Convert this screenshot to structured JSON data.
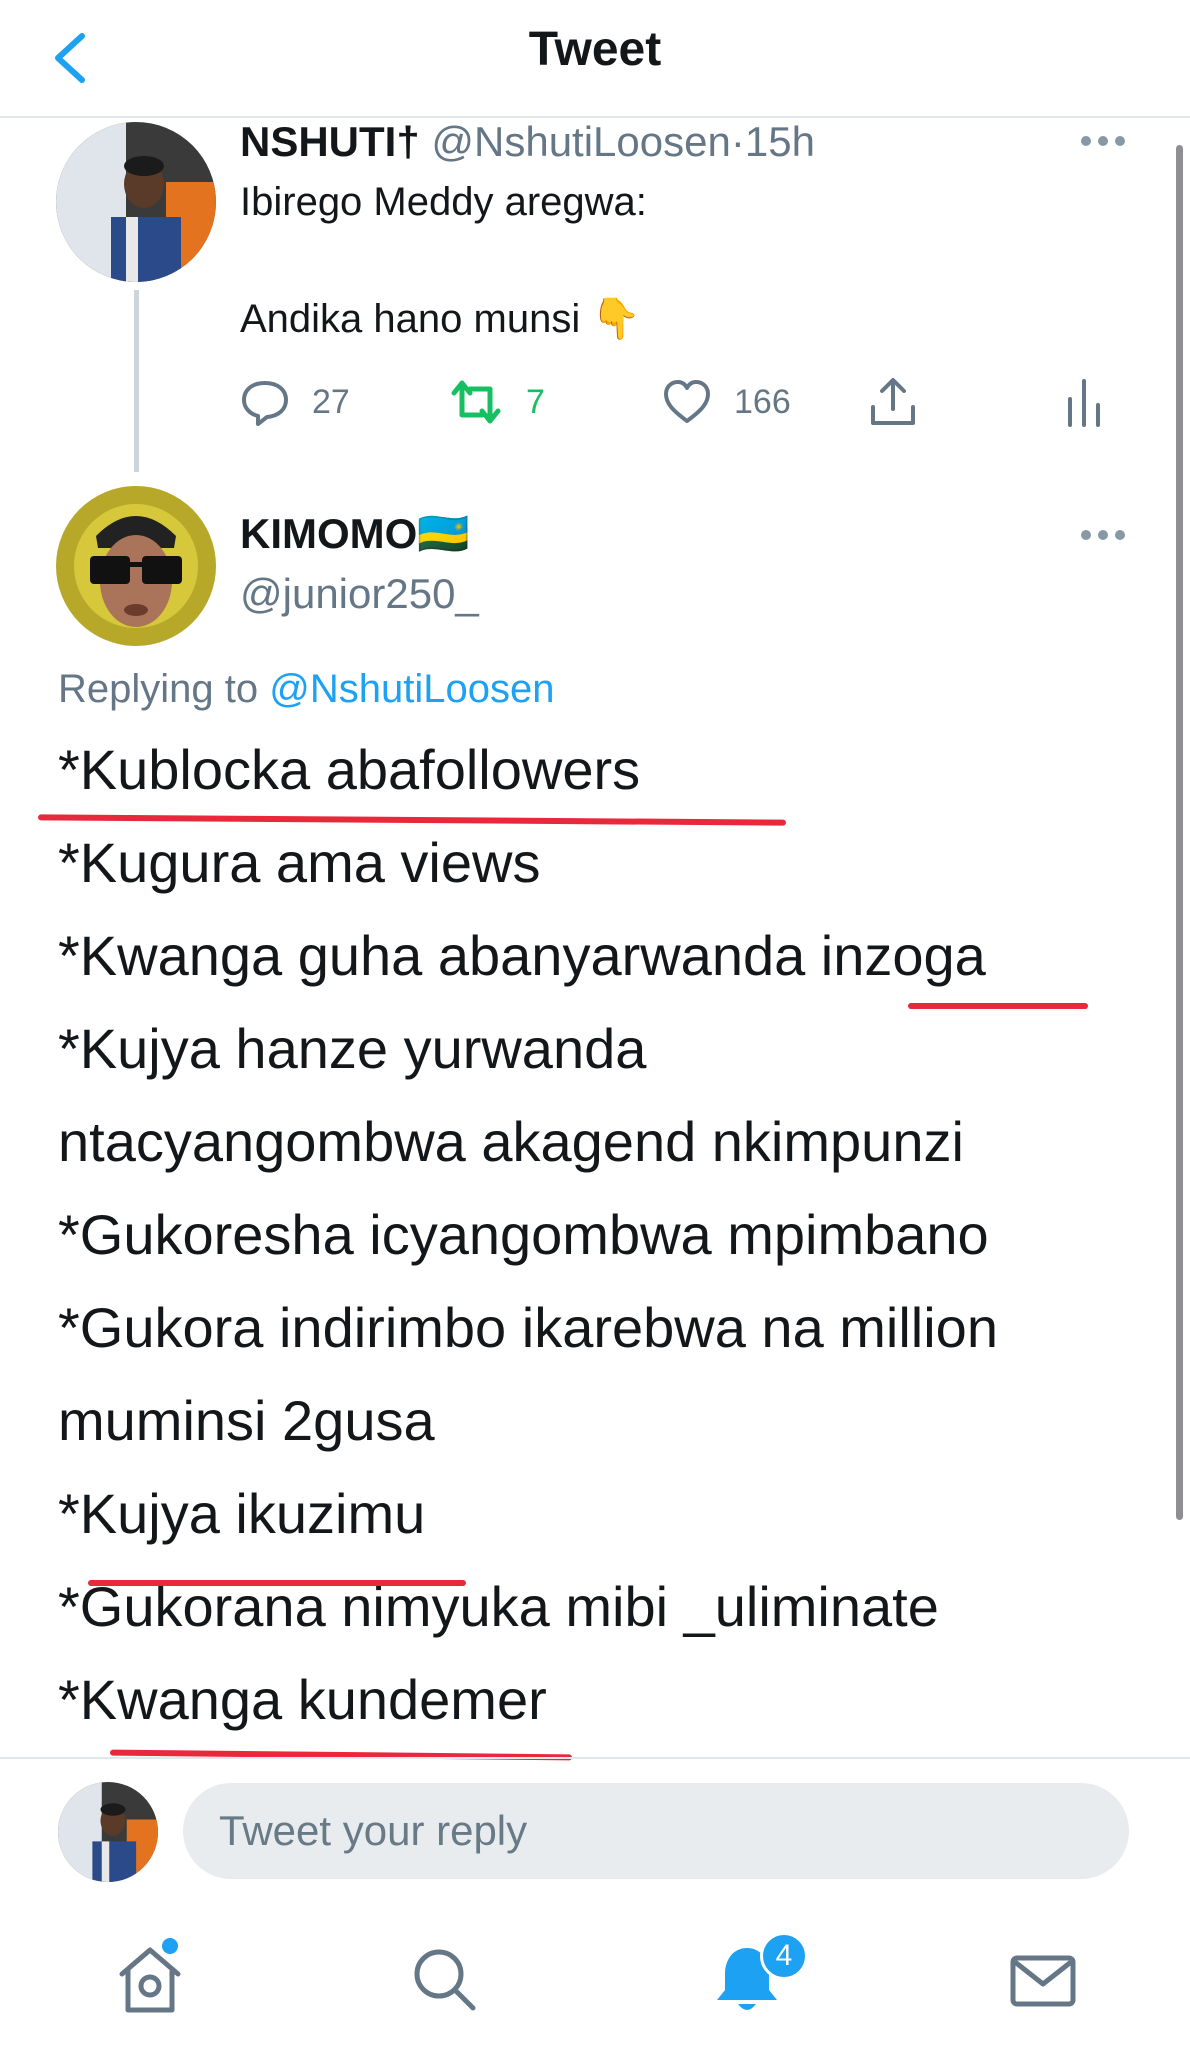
{
  "header": {
    "title": "Tweet"
  },
  "parent_tweet": {
    "name": "NSHUTI†",
    "handle": "@NshutiLoosen",
    "separator": "·",
    "time": "15h",
    "text_line1": "Ibirego Meddy aregwa:",
    "text_line2": "Andika hano munsi 👇",
    "reply_count": "27",
    "retweet_count": "7",
    "like_count": "166"
  },
  "reply_tweet": {
    "name": "KIMOMO",
    "flag": "🇷🇼",
    "handle": "@junior250_",
    "replying_prefix": "Replying to",
    "replying_handle": "@NshutiLoosen",
    "lines": [
      "*Kublocka abafollowers",
      "*Kugura ama views",
      "*Kwanga guha abanyarwanda inzoga",
      "*Kujya hanze yurwanda",
      "ntacyangombwa akagend nkimpunzi",
      "*Gukoresha icyangombwa mpimbano",
      "*Gukora indirimbo ikarebwa na million",
      "muminsi 2gusa",
      "*Kujya ikuzimu",
      "*Gukorana nimyuka mibi _uliminate",
      "*Kwanga kundemer"
    ]
  },
  "composer": {
    "placeholder": "Tweet your reply"
  },
  "tabbar": {
    "notification_badge": "4"
  },
  "colors": {
    "accent": "#1da1f2",
    "retweet_green": "#17bf63",
    "secondary_text": "#657786",
    "annotation_red": "#e8283b"
  }
}
